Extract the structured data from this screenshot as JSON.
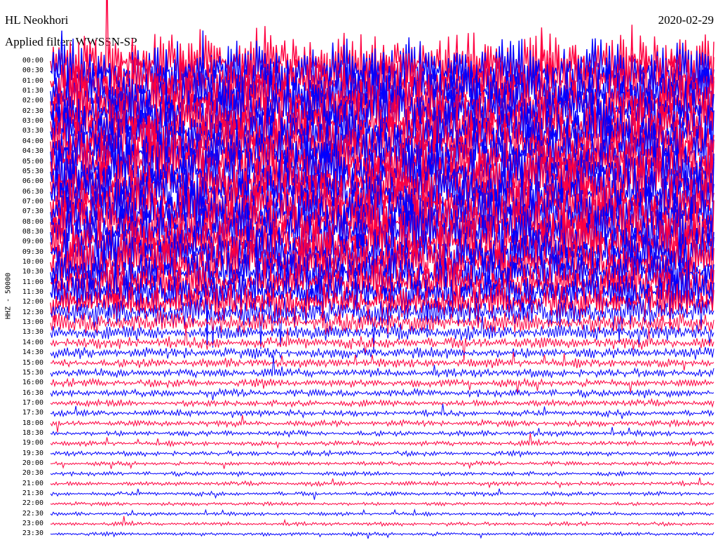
{
  "header": {
    "station": "HL Neokhori",
    "filter": "Applied filter: WWSSN-SP",
    "date": "2020-02-29"
  },
  "chart_data": {
    "type": "line",
    "title": "HL Neokhori",
    "subtitle": "Applied filter: WWSSN-SP",
    "ylabel": "HHZ - 50000",
    "row_labels": [
      "00:00",
      "00:30",
      "01:00",
      "01:30",
      "02:00",
      "02:30",
      "03:00",
      "03:30",
      "04:00",
      "04:30",
      "05:00",
      "05:30",
      "06:00",
      "06:30",
      "07:00",
      "07:30",
      "08:00",
      "08:30",
      "09:00",
      "09:30",
      "10:00",
      "10:30",
      "11:00",
      "11:30",
      "12:00",
      "12:30",
      "13:00",
      "13:30",
      "14:00",
      "14:30",
      "15:00",
      "15:30",
      "16:00",
      "16:30",
      "17:00",
      "17:30",
      "18:00",
      "18:30",
      "19:00",
      "19:30",
      "20:00",
      "20:30",
      "21:00",
      "21:30",
      "22:00",
      "22:30",
      "23:00",
      "23:30"
    ],
    "trace_colors": [
      "#ff0040",
      "#0000ff"
    ],
    "row_amplitude": [
      1.0,
      1.0,
      1.0,
      1.0,
      1.0,
      1.0,
      1.0,
      1.0,
      1.0,
      1.0,
      1.0,
      1.0,
      1.0,
      1.0,
      1.0,
      1.0,
      1.0,
      1.0,
      0.95,
      0.9,
      0.85,
      0.8,
      0.75,
      0.7,
      0.6,
      0.5,
      0.35,
      0.25,
      0.2,
      0.18,
      0.15,
      0.14,
      0.13,
      0.12,
      0.11,
      0.1,
      0.1,
      0.09,
      0.08,
      0.08,
      0.07,
      0.07,
      0.07,
      0.07,
      0.06,
      0.06,
      0.06,
      0.06
    ]
  }
}
